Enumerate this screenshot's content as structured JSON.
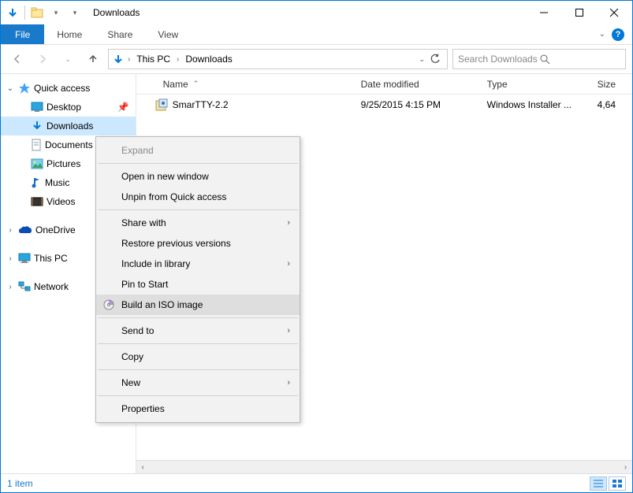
{
  "title": "Downloads",
  "ribbon": {
    "file": "File",
    "tabs": [
      "Home",
      "Share",
      "View"
    ]
  },
  "breadcrumbs": [
    "This PC",
    "Downloads"
  ],
  "search_placeholder": "Search Downloads",
  "tree": {
    "quick_access": "Quick access",
    "desktop": "Desktop",
    "downloads": "Downloads",
    "documents": "Documents",
    "pictures": "Pictures",
    "music": "Music",
    "videos": "Videos",
    "onedrive": "OneDrive",
    "this_pc": "This PC",
    "network": "Network"
  },
  "columns": {
    "name": "Name",
    "date": "Date modified",
    "type": "Type",
    "size": "Size"
  },
  "files": [
    {
      "name": "SmarTTY-2.2",
      "date": "9/25/2015 4:15 PM",
      "type": "Windows Installer ...",
      "size": "4,64"
    }
  ],
  "context_menu": {
    "expand": "Expand",
    "open_new": "Open in new window",
    "unpin": "Unpin from Quick access",
    "share_with": "Share with",
    "restore": "Restore previous versions",
    "include": "Include in library",
    "pin_start": "Pin to Start",
    "build_iso": "Build an ISO image",
    "send_to": "Send to",
    "copy": "Copy",
    "new": "New",
    "properties": "Properties"
  },
  "status": {
    "count": "1 item"
  }
}
